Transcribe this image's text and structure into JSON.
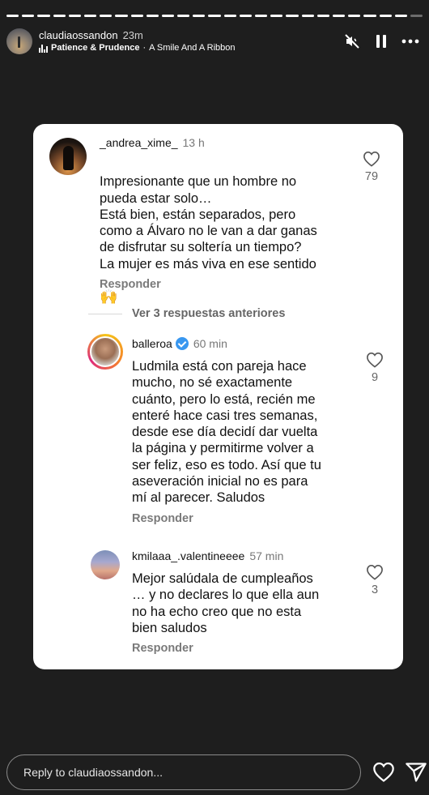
{
  "story": {
    "progress_segments_total": 27,
    "progress_segments_done": 26,
    "username": "claudiaossandon",
    "time": "23m",
    "song_title": "Patience & Prudence",
    "song_separator": "·",
    "song_name": "A Smile And A Ribbon",
    "controls": [
      "mute-icon",
      "pause-icon",
      "more-icon"
    ]
  },
  "comments": {
    "main": {
      "username": "_andrea_xime_",
      "time": "13 h",
      "text": "Impresionante que un hombre no\npueda estar solo…\nEstá bien, están separados, pero\ncomo a Álvaro no le van a dar ganas\nde disfrutar su soltería un tiempo?\nLa mujer es más viva en ese sentido",
      "emoji": "🙌",
      "reply_label": "Responder",
      "likes": "79"
    },
    "view_more": "Ver 3 respuestas anteriores",
    "reply1": {
      "username": "balleroa",
      "verified": true,
      "time": "60 min",
      "text": "Ludmila está con pareja hace\nmucho, no sé exactamente\ncuánto, pero lo está, recién me\nenteré hace casi tres semanas,\ndesde ese día decidí dar vuelta\nla página y permitirme volver a\nser feliz, eso es todo. Así que tu\naseveración inicial no es para\nmí al parecer. Saludos",
      "reply_label": "Responder",
      "likes": "9"
    },
    "reply2": {
      "username": "kmilaaa_.valentineeee",
      "time": "57 min",
      "text": "Mejor salúdala de cumpleaños\n… y no declares lo que ella aun\nno ha echo creo que no esta\nbien saludos",
      "reply_label": "Responder",
      "likes": "3"
    }
  },
  "footer": {
    "reply_placeholder": "Reply to claudiaossandon...",
    "icons": [
      "heart-icon",
      "send-icon"
    ]
  },
  "colors": {
    "background": "#1e1e1e",
    "card": "#ffffff",
    "verified": "#3897f0"
  }
}
